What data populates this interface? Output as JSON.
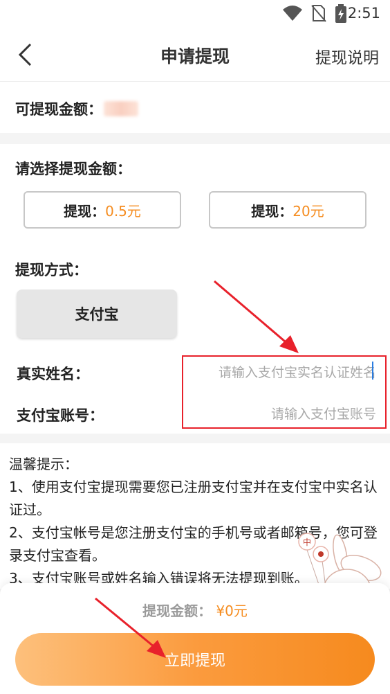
{
  "status_bar": {
    "time": "2:51"
  },
  "header": {
    "title": "申请提现",
    "help_label": "提现说明"
  },
  "available": {
    "label": "可提现金额："
  },
  "select_amount": {
    "label": "请选择提现金额：",
    "options": [
      {
        "prefix": "提现：",
        "value": "0.5元"
      },
      {
        "prefix": "提现：",
        "value": "20元"
      }
    ]
  },
  "method": {
    "label": "提现方式：",
    "option": "支付宝"
  },
  "form": {
    "real_name_label": "真实姓名：",
    "real_name_placeholder": "请输入支付宝实名认证姓名",
    "account_label": "支付宝账号：",
    "account_placeholder": "请输入支付宝账号"
  },
  "tips": {
    "title": "温馨提示：",
    "lines": [
      "1、使用支付宝提现需要您已注册支付宝并在支付宝中实名认证过。",
      "2、支付宝帐号是您注册支付宝的手机号或者邮箱号，您可登录支付宝查看。",
      "3、支付宝账号或姓名输入错误将无法提现到账。"
    ]
  },
  "summary": {
    "label": "提现金额：",
    "value": "¥0元"
  },
  "submit_label": "立即提现",
  "colors": {
    "accent": "#f58c1f",
    "annotation": "#e8212b"
  },
  "sticker": {
    "badge_text": "中"
  }
}
